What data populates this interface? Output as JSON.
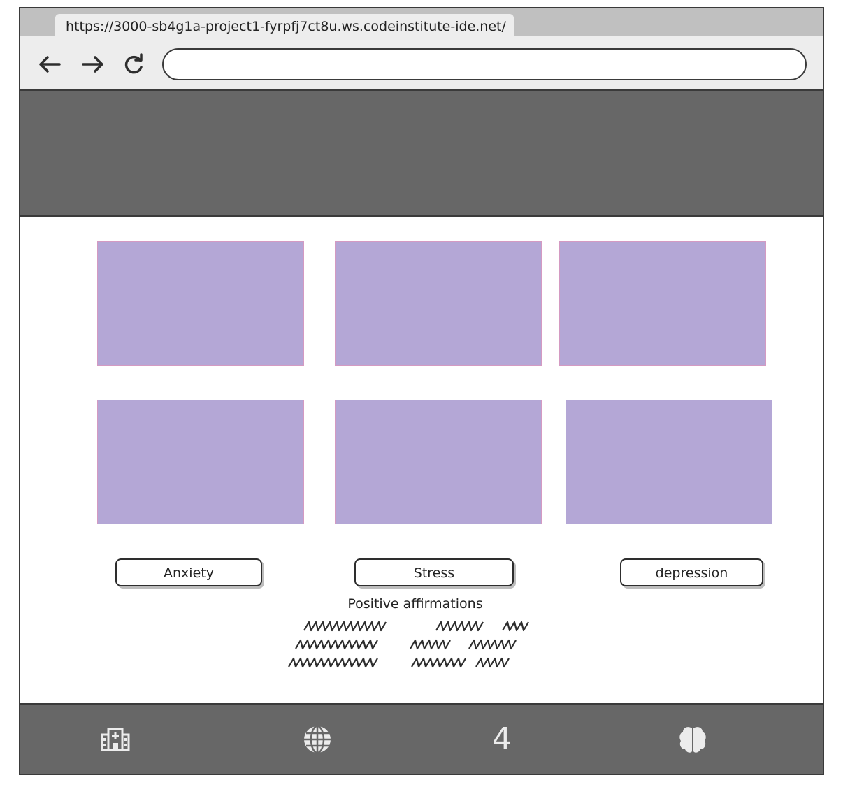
{
  "browser": {
    "tab_url": "https://3000-sb4g1a-project1-fyrpfj7ct8u.ws.codeinstitute-ide.net/",
    "address_value": "",
    "nav": {
      "back_icon": "arrow-left-icon",
      "forward_icon": "arrow-right-icon",
      "reload_icon": "reload-icon"
    }
  },
  "colors": {
    "header_bg": "#676767",
    "card_fill": "#b4a7d6",
    "card_border": "#d49ac2",
    "footer_bg": "#676767",
    "footer_icon": "#ececec"
  },
  "cards": [
    {
      "name": "image-placeholder"
    },
    {
      "name": "image-placeholder"
    },
    {
      "name": "image-placeholder"
    },
    {
      "name": "image-placeholder"
    },
    {
      "name": "image-placeholder"
    },
    {
      "name": "image-placeholder"
    }
  ],
  "topics": {
    "anxiety": "Anxiety",
    "stress": "Stress",
    "depression": "depression"
  },
  "affirmations": {
    "title": "Positive affirmations"
  },
  "footer": {
    "icons": [
      "hospital-icon",
      "globe-icon",
      "four-icon",
      "brain-icon"
    ],
    "four_text": "4"
  }
}
